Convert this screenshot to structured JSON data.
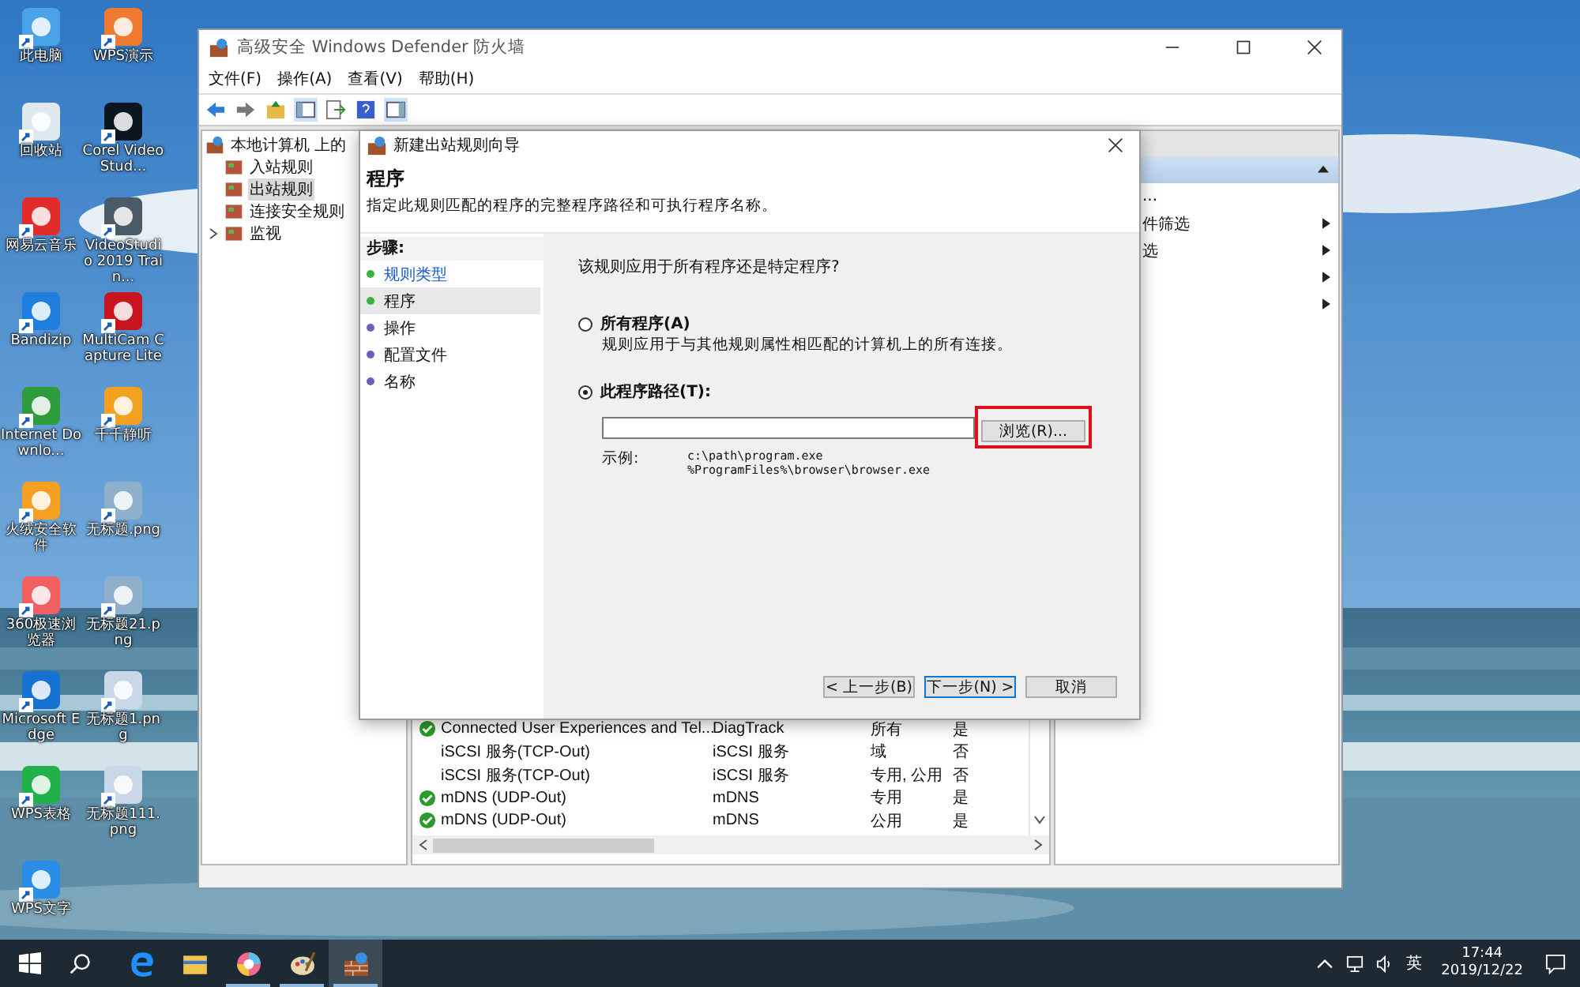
{
  "desktop": {
    "columns": [
      [
        {
          "label": "此电脑"
        },
        {
          "label": "回收站"
        },
        {
          "label": "网易云音乐"
        },
        {
          "label": "Bandizip"
        },
        {
          "label": "Internet Downlo..."
        },
        {
          "label": "火绒安全软件"
        },
        {
          "label": "360极速浏览器"
        },
        {
          "label": "Microsoft Edge"
        },
        {
          "label": "WPS表格"
        },
        {
          "label": "WPS文字"
        }
      ],
      [
        {
          "label": "WPS演示"
        },
        {
          "label": "Corel VideoStud..."
        },
        {
          "label": "VideoStudio 2019 Train..."
        },
        {
          "label": "MultiCam Capture Lite"
        },
        {
          "label": "千千静听"
        },
        {
          "label": "无标题.png"
        },
        {
          "label": "无标题21.png"
        },
        {
          "label": "无标题1.png"
        },
        {
          "label": "无标题111.png"
        }
      ]
    ]
  },
  "window": {
    "title": "高级安全 Windows Defender 防火墙",
    "menu": [
      "文件(F)",
      "操作(A)",
      "查看(V)",
      "帮助(H)"
    ],
    "tree": {
      "label": "本地计算机 上的",
      "children": [
        {
          "label": "入站规则",
          "selected": false
        },
        {
          "label": "出站规则",
          "selected": true
        },
        {
          "label": "连接安全规则",
          "selected": false
        },
        {
          "label": "监视",
          "selected": false,
          "expanded": false
        }
      ]
    },
    "rules": [
      {
        "name": "Connected User Experiences and Tel...",
        "group": "DiagTrack",
        "profile": "所有",
        "enabled": "是",
        "active": true
      },
      {
        "name": "iSCSI 服务(TCP-Out)",
        "group": "iSCSI 服务",
        "profile": "域",
        "enabled": "否",
        "active": false
      },
      {
        "name": "iSCSI 服务(TCP-Out)",
        "group": "iSCSI 服务",
        "profile": "专用, 公用",
        "enabled": "否",
        "active": false
      },
      {
        "name": "mDNS (UDP-Out)",
        "group": "mDNS",
        "profile": "专用",
        "enabled": "是",
        "active": true
      },
      {
        "name": "mDNS (UDP-Out)",
        "group": "mDNS",
        "profile": "公用",
        "enabled": "是",
        "active": true
      }
    ],
    "actions": [
      {
        "label": "...",
        "has_submenu": false
      },
      {
        "label": "件筛选",
        "has_submenu": true
      },
      {
        "label": "选",
        "has_submenu": true
      },
      {
        "has_submenu": true
      },
      {
        "has_submenu": true
      }
    ]
  },
  "dialog": {
    "title": "新建出站规则向导",
    "heading": "程序",
    "description": "指定此规则匹配的程序的完整程序路径和可执行程序名称。",
    "steps_label": "步骤:",
    "steps": [
      {
        "label": "规则类型",
        "done": true,
        "selected": false
      },
      {
        "label": "程序",
        "done": true,
        "selected": true
      },
      {
        "label": "操作",
        "done": false,
        "selected": false
      },
      {
        "label": "配置文件",
        "done": false,
        "selected": false
      },
      {
        "label": "名称",
        "done": false,
        "selected": false
      }
    ],
    "question": "该规则应用于所有程序还是特定程序?",
    "options": [
      {
        "label": "所有程序(A)",
        "description": "规则应用于与其他规则属性相匹配的计算机上的所有连接。",
        "selected": false
      },
      {
        "label": "此程序路径(T):",
        "selected": true
      }
    ],
    "browse_button": {
      "label": "浏览(R)...",
      "highlighted": true
    },
    "example_label": "示例:",
    "examples": [
      "c:\\path\\program.exe",
      "%ProgramFiles%\\browser\\browser.exe"
    ],
    "buttons": [
      {
        "label": "< 上一步(B)",
        "default": false
      },
      {
        "label": "下一步(N) >",
        "default": true
      },
      {
        "label": "取消",
        "default": false
      }
    ]
  },
  "taskbar": {
    "apps": [
      {
        "running": false,
        "active": false
      },
      {
        "running": false,
        "active": false
      },
      {
        "running": true,
        "active": false
      },
      {
        "running": true,
        "active": false
      },
      {
        "running": true,
        "active": true
      }
    ],
    "input_method": "英",
    "time": "17:44",
    "date": "2019/12/22"
  }
}
